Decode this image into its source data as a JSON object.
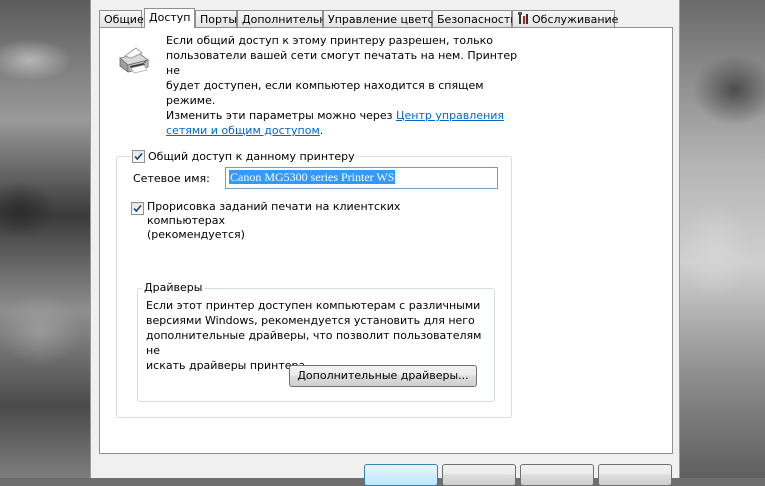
{
  "tabs": [
    {
      "label": "Общие",
      "active": false
    },
    {
      "label": "Доступ",
      "active": true
    },
    {
      "label": "Порты",
      "active": false
    },
    {
      "label": "Дополнительно",
      "active": false
    },
    {
      "label": "Управление цветом",
      "active": false
    },
    {
      "label": "Безопасность",
      "active": false
    },
    {
      "label": "Обслуживание",
      "active": false,
      "icon": "maintenance-icon"
    }
  ],
  "info": {
    "line1": "Если общий доступ к этому принтеру разрешен, только",
    "line2": "пользователи вашей сети смогут печатать на нем. Принтер не",
    "line3": "будет доступен, если компьютер находится в спящем режиме.",
    "line4_prefix": "Изменить эти параметры можно через ",
    "link_part1": "Центр управления",
    "link_part2": "сетями и общим доступом",
    "line5_suffix": "."
  },
  "sharing": {
    "share_label": "Общий доступ к данному принтеру",
    "share_checked": true,
    "network_name_label": "Сетевое имя:",
    "network_name_value": "Canon MG5300 series Printer WS",
    "render_label_line1": "Прорисовка заданий печати на клиентских компьютерах",
    "render_label_line2": "(рекомендуется)",
    "render_checked": true
  },
  "drivers": {
    "legend": "Драйверы",
    "text_line1": "Если этот принтер доступен компьютерам с различными",
    "text_line2": "версиями Windows, рекомендуется установить для него",
    "text_line3": "дополнительные драйверы, что позволит пользователям не",
    "text_line4": "искать драйверы принтера.",
    "button_label": "Дополнительные драйверы..."
  },
  "colors": {
    "link": "#0066cc",
    "selection": "#3399ff"
  }
}
